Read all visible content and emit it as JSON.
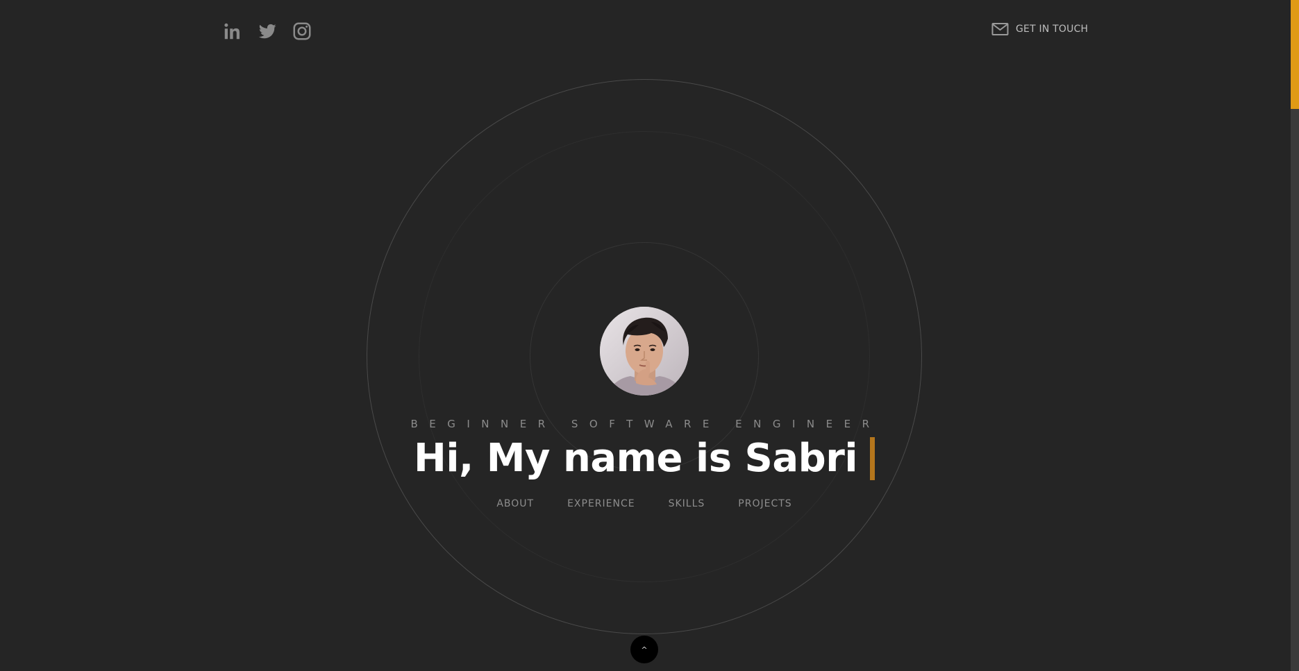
{
  "header": {
    "social": [
      {
        "name": "linkedin-icon"
      },
      {
        "name": "twitter-icon"
      },
      {
        "name": "instagram-icon"
      }
    ],
    "contact": {
      "icon": "mail-icon",
      "label": "GET IN TOUCH"
    }
  },
  "hero": {
    "avatar": "profile-photo",
    "tagline": "BEGINNER SOFTWARE ENGINEER",
    "headline": "Hi, My name is Sabri",
    "menu": [
      "ABOUT",
      "EXPERIENCE",
      "SKILLS",
      "PROJECTS"
    ]
  },
  "scroll_top": {
    "label": "^"
  },
  "colors": {
    "background": "#252525",
    "accent": "#e09a16",
    "cursor": "#b4761c",
    "text": "#ffffff",
    "muted": "#8c8c8c"
  }
}
